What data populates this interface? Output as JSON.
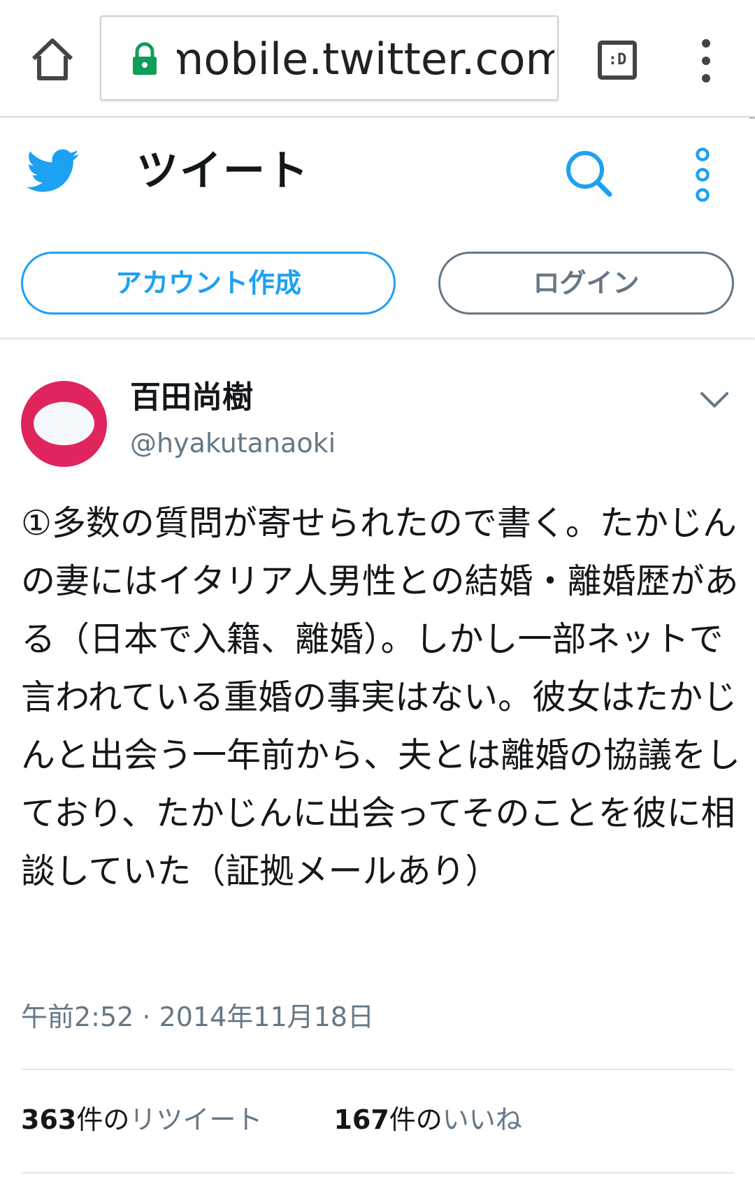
{
  "browser": {
    "url": "mobile.twitter.com/h",
    "tabs_icon_label": ":D",
    "home_icon": "home-icon",
    "lock_icon": "lock-icon",
    "menu_icon": "more-vert-icon"
  },
  "header": {
    "title": "ツイート",
    "logo_icon": "twitter-bird-icon",
    "search_icon": "search-icon",
    "more_icon": "more-vert-icon",
    "signup_label": "アカウント作成",
    "login_label": "ログイン"
  },
  "tweet": {
    "display_name": "百田尚樹",
    "handle": "@hyakutanaoki",
    "text": "①多数の質問が寄せられたので書く。たかじんの妻にはイタリア人男性との結婚・離婚歴がある（日本で入籍、離婚）。しかし一部ネットで言われている重婚の事実はない。彼女はたかじんと出会う一年前から、夫とは離婚の協議をしており、たかじんに出会ってそのことを彼に相談していた（証拠メールあり）",
    "timestamp": "午前2:52 · 2014年11月18日",
    "retweet_count": "363",
    "retweet_suffix": "件の",
    "retweet_label": "リツイート",
    "like_count": "167",
    "like_suffix": "件の",
    "like_label": "いいね"
  },
  "colors": {
    "accent": "#1da1f2",
    "secondary_text": "#657786",
    "avatar_bg": "#e0245e",
    "lock_green": "#0f9d58"
  }
}
